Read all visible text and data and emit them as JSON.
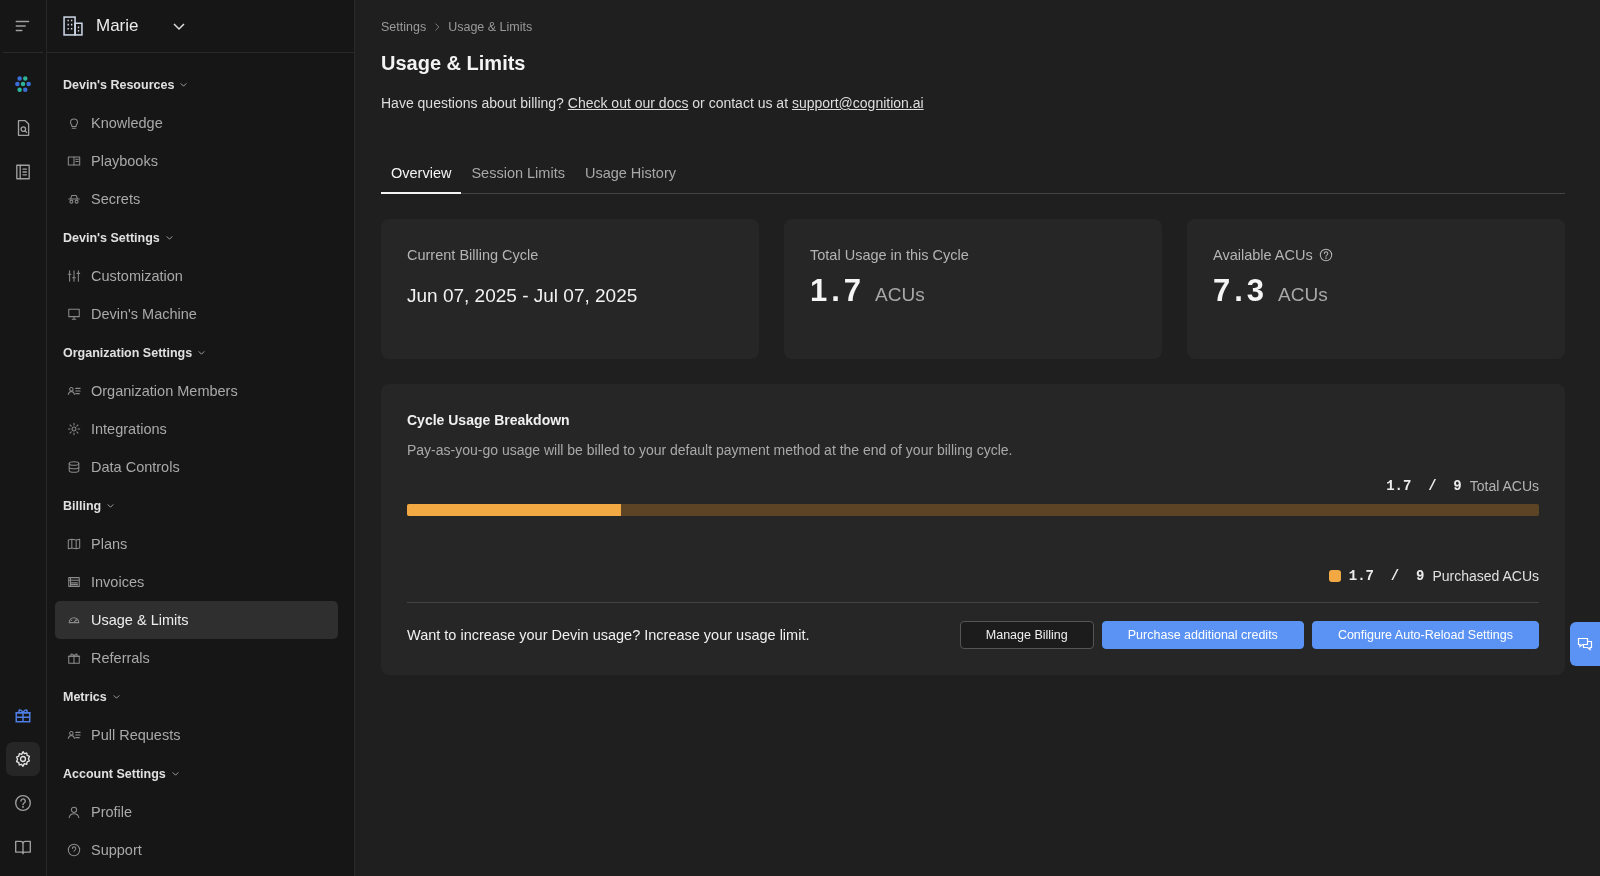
{
  "rail": {
    "top": [
      {
        "selected": false
      },
      {
        "selected": false
      },
      {
        "selected": false
      }
    ],
    "bottom": [
      {
        "selected": false
      },
      {
        "selected": true
      },
      {
        "selected": false
      },
      {
        "selected": false
      }
    ]
  },
  "org": {
    "name": "Marie"
  },
  "sidebar": [
    {
      "title": "Devin's Resources",
      "expanded": true,
      "items": [
        {
          "label": "Knowledge",
          "selected": false
        },
        {
          "label": "Playbooks",
          "selected": false
        },
        {
          "label": "Secrets",
          "selected": false
        }
      ]
    },
    {
      "title": "Devin's Settings",
      "expanded": true,
      "items": [
        {
          "label": "Customization",
          "selected": false
        },
        {
          "label": "Devin's Machine",
          "selected": false
        }
      ]
    },
    {
      "title": "Organization Settings",
      "expanded": true,
      "items": [
        {
          "label": "Organization Members",
          "selected": false
        },
        {
          "label": "Integrations",
          "selected": false
        },
        {
          "label": "Data Controls",
          "selected": false
        }
      ]
    },
    {
      "title": "Billing",
      "expanded": true,
      "items": [
        {
          "label": "Plans",
          "selected": false
        },
        {
          "label": "Invoices",
          "selected": false
        },
        {
          "label": "Usage & Limits",
          "selected": true
        },
        {
          "label": "Referrals",
          "selected": false
        }
      ]
    },
    {
      "title": "Metrics",
      "expanded": true,
      "items": [
        {
          "label": "Pull Requests",
          "selected": false
        }
      ]
    },
    {
      "title": "Account Settings",
      "expanded": true,
      "items": [
        {
          "label": "Profile",
          "selected": false
        },
        {
          "label": "Support",
          "selected": false
        }
      ]
    }
  ],
  "breadcrumb": [
    "Settings",
    "Usage & Limits"
  ],
  "title": "Usage & Limits",
  "intro": [
    {
      "kind": "text",
      "text": "Have questions about billing?"
    },
    {
      "kind": "link",
      "text": "Check out our docs"
    },
    {
      "kind": "text",
      "text": "or contact us at"
    },
    {
      "kind": "link",
      "text": "support@cognition.ai"
    }
  ],
  "tabs": [
    {
      "label": "Overview",
      "selected": true
    },
    {
      "label": "Session Limits",
      "selected": false
    },
    {
      "label": "Usage History",
      "selected": false
    }
  ],
  "cards": [
    {
      "kind": "date",
      "label": "Current Billing Cycle",
      "value": "Jun 07, 2025 - Jul 07, 2025"
    },
    {
      "kind": "amount",
      "label": "Total Usage in this Cycle",
      "value": "1.7",
      "unit": "ACUs"
    },
    {
      "kind": "amount",
      "label": "Available ACUs",
      "help": true,
      "value": "7.3",
      "unit": "ACUs"
    }
  ],
  "breakdown": {
    "title": "Cycle Usage Breakdown",
    "description": "Pay-as-you-go usage will be billed to your default payment method at the end of your billing cycle.",
    "total_reading": "1.7  /  9",
    "total_unit": "Total ACUs",
    "level": 0.189,
    "legend": [
      {
        "color": "#f2a944",
        "reading": "1.7  /  9",
        "label": "Purchased ACUs"
      }
    ],
    "footer_text": "Want to increase your Devin usage? Increase your usage limit.",
    "buttons": [
      {
        "kind": "secondary",
        "label": "Manage Billing"
      },
      {
        "kind": "primary",
        "label": "Purchase additional credits"
      },
      {
        "kind": "primary",
        "label": "Configure Auto-Reload Settings"
      }
    ]
  }
}
